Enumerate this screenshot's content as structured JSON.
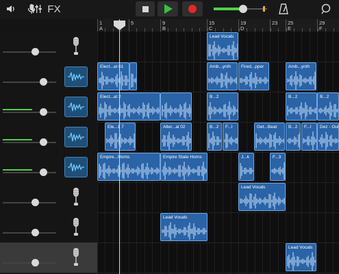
{
  "toolbar": {
    "icons": [
      "speaker-icon",
      "microphone-icon",
      "mixer-icon",
      "fx-label",
      "stop-icon",
      "play-icon",
      "record-icon",
      "master-volume-slider",
      "metronome-icon",
      "loop-icon"
    ],
    "fx_label": "FX",
    "master_volume_level": 0.55,
    "accent_play": "#36c23f",
    "accent_record": "#e52727"
  },
  "ruler": {
    "bars": [
      {
        "num": "1",
        "sec": "A"
      },
      {
        "num": "5",
        "sec": ""
      },
      {
        "num": "9",
        "sec": "B"
      },
      {
        "num": "15",
        "sec": "C"
      },
      {
        "num": "19",
        "sec": "D"
      },
      {
        "num": "23",
        "sec": ""
      },
      {
        "num": "25",
        "sec": "E"
      },
      {
        "num": "29",
        "sec": "F"
      }
    ]
  },
  "tracks": [
    {
      "name": "track-1",
      "instrument": "microphone-icon",
      "volume": 0.6,
      "meter": 0,
      "selected": false
    },
    {
      "name": "track-2",
      "instrument": "synth-wave-icon",
      "volume": 0.75,
      "meter": 0,
      "selected": false
    },
    {
      "name": "track-3",
      "instrument": "synth-wave-icon",
      "volume": 0.75,
      "meter": 0.55,
      "selected": false
    },
    {
      "name": "track-4",
      "instrument": "synth-wave-icon",
      "volume": 0.75,
      "meter": 0.55,
      "selected": false
    },
    {
      "name": "track-5",
      "instrument": "synth-wave-icon",
      "volume": 0.75,
      "meter": 0.55,
      "selected": false
    },
    {
      "name": "track-6",
      "instrument": "microphone-icon",
      "volume": 0.6,
      "meter": 0,
      "selected": false
    },
    {
      "name": "track-7",
      "instrument": "microphone-icon",
      "volume": 0.6,
      "meter": 0,
      "selected": false
    },
    {
      "name": "track-8",
      "instrument": "microphone-icon",
      "volume": 0.6,
      "meter": 0,
      "selected": true
    }
  ],
  "regions": [
    {
      "track": 0,
      "label": "Lead Vocals"
    },
    {
      "track": 1,
      "label": "Elect...at 01"
    },
    {
      "track": 1,
      "label": ""
    },
    {
      "track": 1,
      "label": "Amb...ynth"
    },
    {
      "track": 1,
      "label": "Fired...pper"
    },
    {
      "track": 1,
      "label": "Amb...ynth"
    },
    {
      "track": 2,
      "label": "Elect...at 2"
    },
    {
      "track": 2,
      "label": ""
    },
    {
      "track": 2,
      "label": "B...2"
    },
    {
      "track": 2,
      "label": "B...2"
    },
    {
      "track": 2,
      "label": "B...2"
    },
    {
      "track": 3,
      "label": "Ele...1 7"
    },
    {
      "track": 3,
      "label": "Alter...al 02"
    },
    {
      "track": 3,
      "label": "B...2"
    },
    {
      "track": 3,
      "label": "F...l"
    },
    {
      "track": 3,
      "label": "Get...Beat"
    },
    {
      "track": 3,
      "label": "B...2"
    },
    {
      "track": 3,
      "label": "F...l"
    },
    {
      "track": 3,
      "label": "Dez - Outr"
    },
    {
      "track": 4,
      "label": "Empire...Horns"
    },
    {
      "track": 4,
      "label": "Empire State Horns"
    },
    {
      "track": 4,
      "label": "J...k"
    },
    {
      "track": 4,
      "label": "F...3"
    },
    {
      "track": 5,
      "label": "Lead Vocals"
    },
    {
      "track": 6,
      "label": "Lead Vocals"
    },
    {
      "track": 7,
      "label": "Lead Vocals"
    }
  ]
}
